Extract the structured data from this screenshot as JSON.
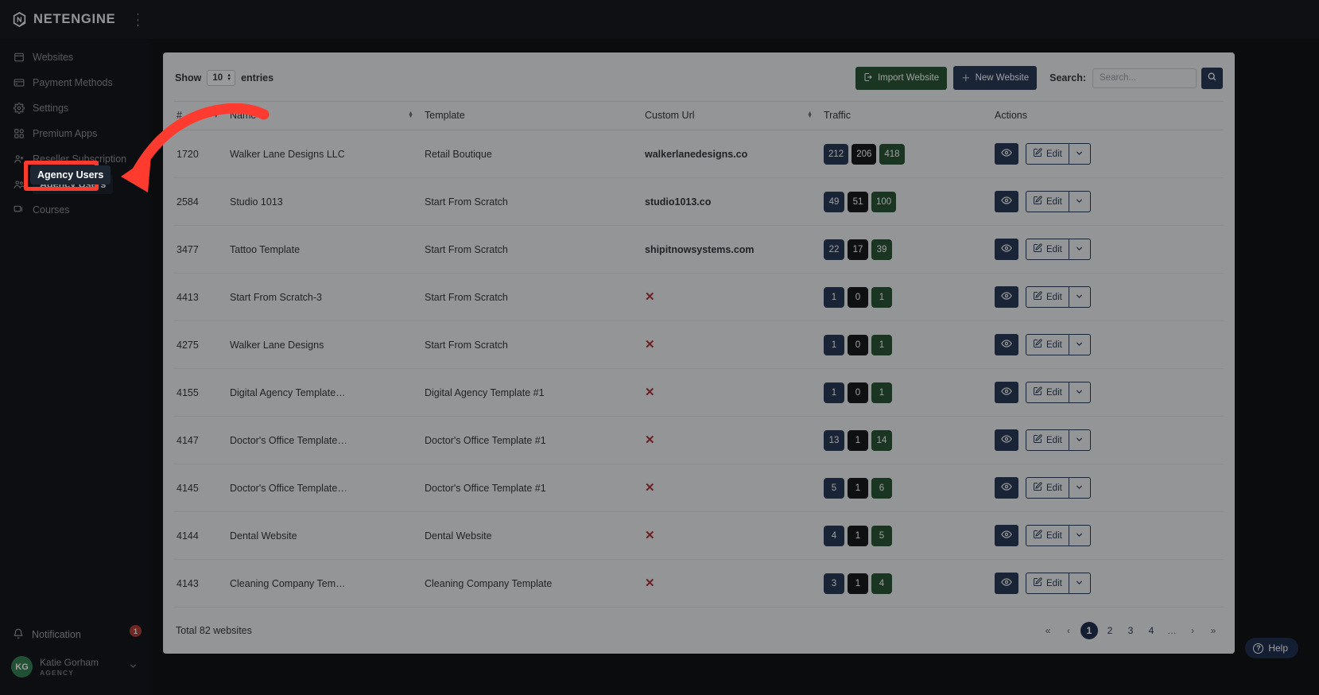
{
  "brand": {
    "name": "NETENGINE",
    "logo_icon": "gear-logo-icon",
    "menu_icon": "hamburger-icon"
  },
  "sidebar": {
    "items": [
      {
        "label": "Websites",
        "icon": "browser-window-icon",
        "active": false
      },
      {
        "label": "Payment Methods",
        "icon": "credit-card-icon",
        "active": false
      },
      {
        "label": "Settings",
        "icon": "gear-icon",
        "active": false
      },
      {
        "label": "Premium Apps",
        "icon": "apps-grid-icon",
        "active": false
      },
      {
        "label": "Reseller Subscription",
        "icon": "user-plus-icon",
        "active": false
      },
      {
        "label": "Agency Users",
        "icon": "users-icon",
        "active": true
      },
      {
        "label": "Courses",
        "icon": "presentation-icon",
        "active": false
      }
    ],
    "notification": {
      "label": "Notification",
      "icon": "bell-icon",
      "count": "1"
    },
    "user": {
      "initials": "KG",
      "name": "Katie Gorham",
      "role": "AGENCY",
      "caret_icon": "chevron-down-icon"
    }
  },
  "toolbar": {
    "show_label": "Show",
    "entries_value": "10",
    "entries_label": "entries",
    "import_label": "Import Website",
    "import_icon": "import-icon",
    "new_label": "New Website",
    "new_icon": "plus-icon",
    "search_label": "Search:",
    "search_value": "",
    "search_placeholder": "Search...",
    "search_button_icon": "search-icon"
  },
  "table": {
    "columns": [
      "#",
      "Name",
      "Template",
      "Custom Url",
      "Traffic",
      "Actions"
    ],
    "rows": [
      {
        "id": "1720",
        "name": "Walker Lane Designs LLC",
        "template": "Retail Boutique",
        "url": "walkerlanedesigns.co",
        "url_none": false,
        "traffic": [
          "212",
          "206",
          "418"
        ]
      },
      {
        "id": "2584",
        "name": "Studio 1013",
        "template": "Start From Scratch",
        "url": "studio1013.co",
        "url_none": false,
        "traffic": [
          "49",
          "51",
          "100"
        ]
      },
      {
        "id": "3477",
        "name": "Tattoo Template",
        "template": "Start From Scratch",
        "url": "shipitnowsystems.com",
        "url_none": false,
        "traffic": [
          "22",
          "17",
          "39"
        ]
      },
      {
        "id": "4413",
        "name": "Start From Scratch-3",
        "template": "Start From Scratch",
        "url": "",
        "url_none": true,
        "traffic": [
          "1",
          "0",
          "1"
        ]
      },
      {
        "id": "4275",
        "name": "Walker Lane Designs",
        "template": "Start From Scratch",
        "url": "",
        "url_none": true,
        "traffic": [
          "1",
          "0",
          "1"
        ]
      },
      {
        "id": "4155",
        "name": "Digital Agency Template…",
        "template": "Digital Agency Template #1",
        "url": "",
        "url_none": true,
        "traffic": [
          "1",
          "0",
          "1"
        ]
      },
      {
        "id": "4147",
        "name": "Doctor's Office Template…",
        "template": "Doctor's Office Template #1",
        "url": "",
        "url_none": true,
        "traffic": [
          "13",
          "1",
          "14"
        ]
      },
      {
        "id": "4145",
        "name": "Doctor's Office Template…",
        "template": "Doctor's Office Template #1",
        "url": "",
        "url_none": true,
        "traffic": [
          "5",
          "1",
          "6"
        ]
      },
      {
        "id": "4144",
        "name": "Dental Website",
        "template": "Dental Website",
        "url": "",
        "url_none": true,
        "traffic": [
          "4",
          "1",
          "5"
        ]
      },
      {
        "id": "4143",
        "name": "Cleaning Company Tem…",
        "template": "Cleaning Company Template",
        "url": "",
        "url_none": true,
        "traffic": [
          "3",
          "1",
          "4"
        ]
      }
    ],
    "row_actions": {
      "view_icon": "eye-icon",
      "edit_label": "Edit",
      "edit_icon": "pencil-square-icon",
      "dropdown_icon": "chevron-down-icon"
    },
    "url_none_icon": "x-mark-icon"
  },
  "footer": {
    "total_text": "Total 82 websites",
    "pagination": [
      "«",
      "‹",
      "1",
      "2",
      "3",
      "4",
      "…",
      "›",
      "»"
    ],
    "active_page": "1"
  },
  "help": {
    "label": "Help",
    "icon": "question-circle-icon"
  },
  "annotation": {
    "highlight_label": "Agency Users",
    "arrow_color": "#ff3b2f",
    "box_color": "#ff3b2f"
  },
  "colors": {
    "brand_dark": "#12161d",
    "accent_blue": "#253a66",
    "accent_green": "#1d5c32",
    "danger": "#c8302a",
    "avatar_green": "#1f8a4c"
  }
}
